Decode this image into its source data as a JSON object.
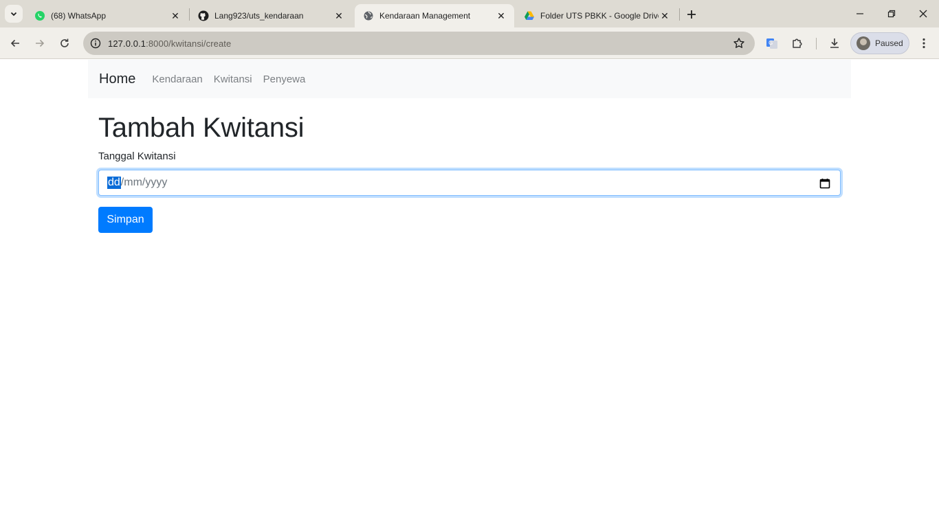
{
  "browser": {
    "tabs": [
      {
        "title": "(68) WhatsApp",
        "icon": "whatsapp-icon",
        "active": false
      },
      {
        "title": "Lang923/uts_kendaraan",
        "icon": "github-icon",
        "active": false
      },
      {
        "title": "Kendaraan Management",
        "icon": "globe-icon",
        "active": true
      },
      {
        "title": "Folder UTS PBKK - Google Drive",
        "icon": "google-drive-icon",
        "active": false
      }
    ],
    "address": {
      "host": "127.0.0.1",
      "path": ":8000/kwitansi/create"
    },
    "profile_label": "Paused"
  },
  "site": {
    "brand": "Home",
    "nav": [
      "Kendaraan",
      "Kwitansi",
      "Penyewa"
    ]
  },
  "form": {
    "title": "Tambah Kwitansi",
    "date_label": "Tanggal Kwitansi",
    "date_placeholder": {
      "day": "dd",
      "rest": "/mm/yyyy"
    },
    "submit_label": "Simpan"
  },
  "colors": {
    "primary": "#007bff",
    "nav_bg": "#f8f9fa",
    "focus_border": "#80bdff"
  }
}
